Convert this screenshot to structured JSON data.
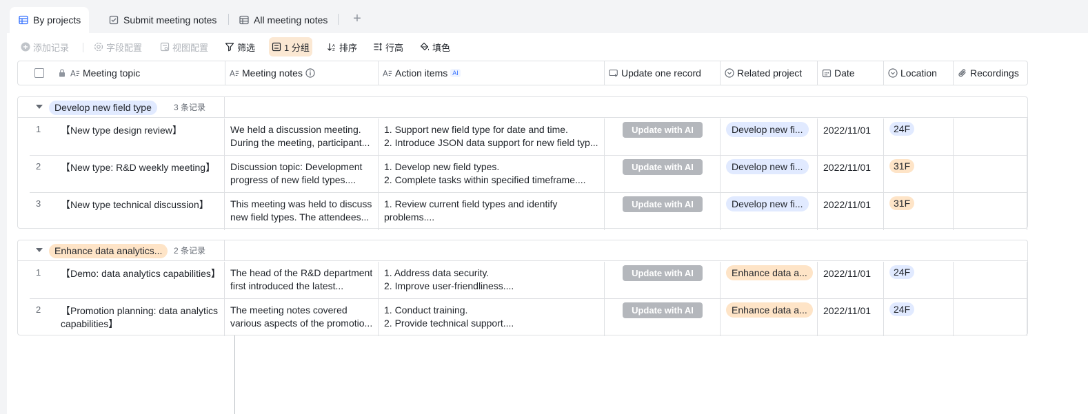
{
  "tabs": [
    {
      "label": "By projects",
      "icon": "table-icon",
      "active": true
    },
    {
      "label": "Submit meeting notes",
      "icon": "form-icon",
      "active": false
    },
    {
      "label": "All meeting notes",
      "icon": "table-icon",
      "active": false
    }
  ],
  "toolbar": {
    "add_record": "添加记录",
    "field_config": "字段配置",
    "view_config": "视图配置",
    "filter": "筛选",
    "group": "1 分组",
    "sort": "排序",
    "row_height": "行高",
    "fill": "填色"
  },
  "columns": {
    "topic": "Meeting topic",
    "notes": "Meeting notes",
    "actions": "Action items",
    "actions_badge": "AI",
    "update": "Update one record",
    "project": "Related project",
    "date": "Date",
    "location": "Location",
    "recordings": "Recordings"
  },
  "colors": {
    "blue_tag": "#e1eaff",
    "orange_tag": "#fee4c7",
    "ai_button": "#b4b7bc",
    "accent": "#3370ff"
  },
  "groups": [
    {
      "name": "Develop new field type",
      "count": "3 条记录",
      "tag_color": "blue",
      "rows": [
        {
          "num": "1",
          "topic": "【New type design review】",
          "notes1": "We held a discussion meeting.",
          "notes2": "During the meeting, participant...",
          "act1": "1. Support new field type for date and time.",
          "act2": "2. Introduce JSON data support for new field typ...",
          "button": "Update with AI",
          "project": "Develop new fi...",
          "date": "2022/11/01",
          "location": "24F",
          "loc_color": "blue"
        },
        {
          "num": "2",
          "topic": "【New type: R&D weekly meeting】",
          "notes1": "Discussion topic: Development",
          "notes2": "progress of new field types....",
          "act1": "1. Develop new field types.",
          "act2": "2. Complete tasks within specified timeframe....",
          "button": "Update with AI",
          "project": "Develop new fi...",
          "date": "2022/11/01",
          "location": "31F",
          "loc_color": "orange"
        },
        {
          "num": "3",
          "topic": "【New type technical discussion】",
          "notes1": "This meeting was held to discuss",
          "notes2": "new field types. The attendees...",
          "act1": "1. Review current field types and identify",
          "act2": "problems....",
          "button": "Update with AI",
          "project": "Develop new fi...",
          "date": "2022/11/01",
          "location": "31F",
          "loc_color": "orange"
        }
      ]
    },
    {
      "name": "Enhance data analytics...",
      "count": "2 条记录",
      "tag_color": "orange",
      "rows": [
        {
          "num": "1",
          "topic": "【Demo: data analytics capabilities】",
          "notes1": "The head of the R&D department",
          "notes2": "first introduced the latest...",
          "act1": "1. Address data security.",
          "act2": "2. Improve user-friendliness....",
          "button": "Update with AI",
          "project": "Enhance data a...",
          "date": "2022/11/01",
          "location": "24F",
          "loc_color": "blue"
        },
        {
          "num": "2",
          "topic": "【Promotion planning: data analytics capabilities】",
          "notes1": "The meeting notes covered",
          "notes2": "various aspects of the promotio...",
          "act1": "1. Conduct training.",
          "act2": "2. Provide technical support....",
          "button": "Update with AI",
          "project": "Enhance data a...",
          "date": "2022/11/01",
          "location": "24F",
          "loc_color": "blue"
        }
      ]
    }
  ]
}
